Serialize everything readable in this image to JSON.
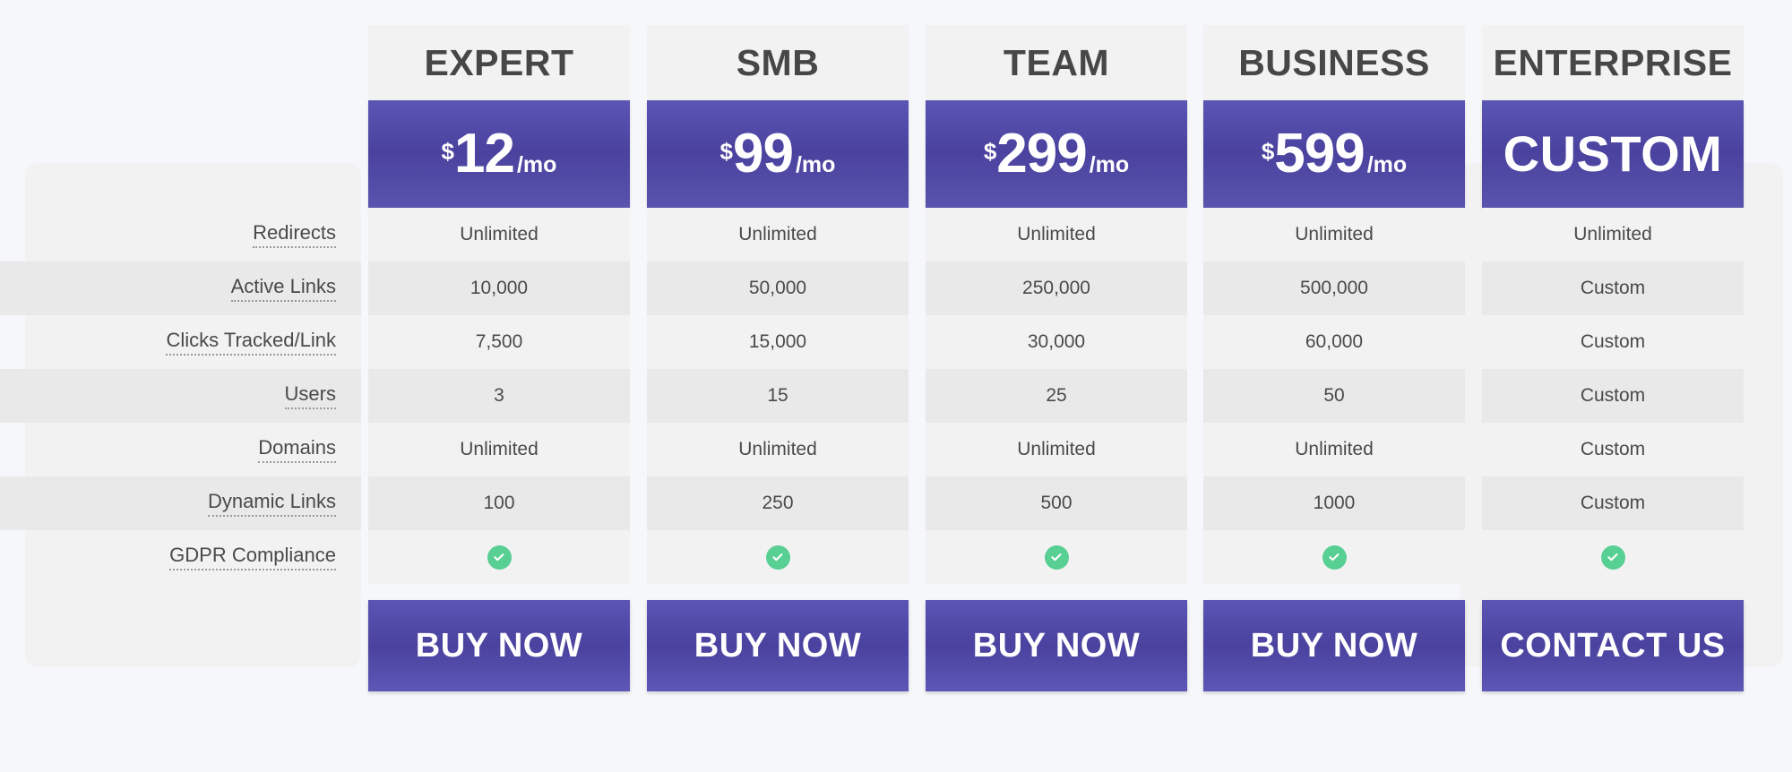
{
  "colors": {
    "page_background": "#f6f7fa",
    "panel": "#f2f2f3",
    "row_light": "#f2f2f2",
    "row_alt": "#e9e9e9",
    "accent_purple": "#4a429e",
    "accent_purple_light": "#5b55b4",
    "tick_green": "#58cf93",
    "text": "#4a4a4a",
    "heading_text": "#474747"
  },
  "plans": [
    {
      "name": "EXPERT",
      "currency": "$",
      "price": "12",
      "period": "/mo",
      "is_custom": false,
      "cta": "BUY NOW",
      "values": [
        "Unlimited",
        "10,000",
        "7,500",
        "3",
        "Unlimited",
        "100"
      ],
      "gdpr": true
    },
    {
      "name": "SMB",
      "currency": "$",
      "price": "99",
      "period": "/mo",
      "is_custom": false,
      "cta": "BUY NOW",
      "values": [
        "Unlimited",
        "50,000",
        "15,000",
        "15",
        "Unlimited",
        "250"
      ],
      "gdpr": true
    },
    {
      "name": "TEAM",
      "currency": "$",
      "price": "299",
      "period": "/mo",
      "is_custom": false,
      "cta": "BUY NOW",
      "values": [
        "Unlimited",
        "250,000",
        "30,000",
        "25",
        "Unlimited",
        "500"
      ],
      "gdpr": true
    },
    {
      "name": "BUSINESS",
      "currency": "$",
      "price": "599",
      "period": "/mo",
      "is_custom": false,
      "cta": "BUY NOW",
      "values": [
        "Unlimited",
        "500,000",
        "60,000",
        "50",
        "Unlimited",
        "1000"
      ],
      "gdpr": true
    },
    {
      "name": "ENTERPRISE",
      "currency": "",
      "price": "CUSTOM",
      "period": "",
      "is_custom": true,
      "cta": "CONTACT US",
      "values": [
        "Unlimited",
        "Custom",
        "Custom",
        "Custom",
        "Custom",
        "Custom"
      ],
      "gdpr": true
    }
  ],
  "features": [
    {
      "label": "Redirects"
    },
    {
      "label": "Active Links"
    },
    {
      "label": "Clicks Tracked/Link"
    },
    {
      "label": "Users"
    },
    {
      "label": "Domains"
    },
    {
      "label": "Dynamic Links"
    },
    {
      "label": "GDPR Compliance"
    }
  ],
  "icons": {
    "check": "check-circle-icon"
  }
}
